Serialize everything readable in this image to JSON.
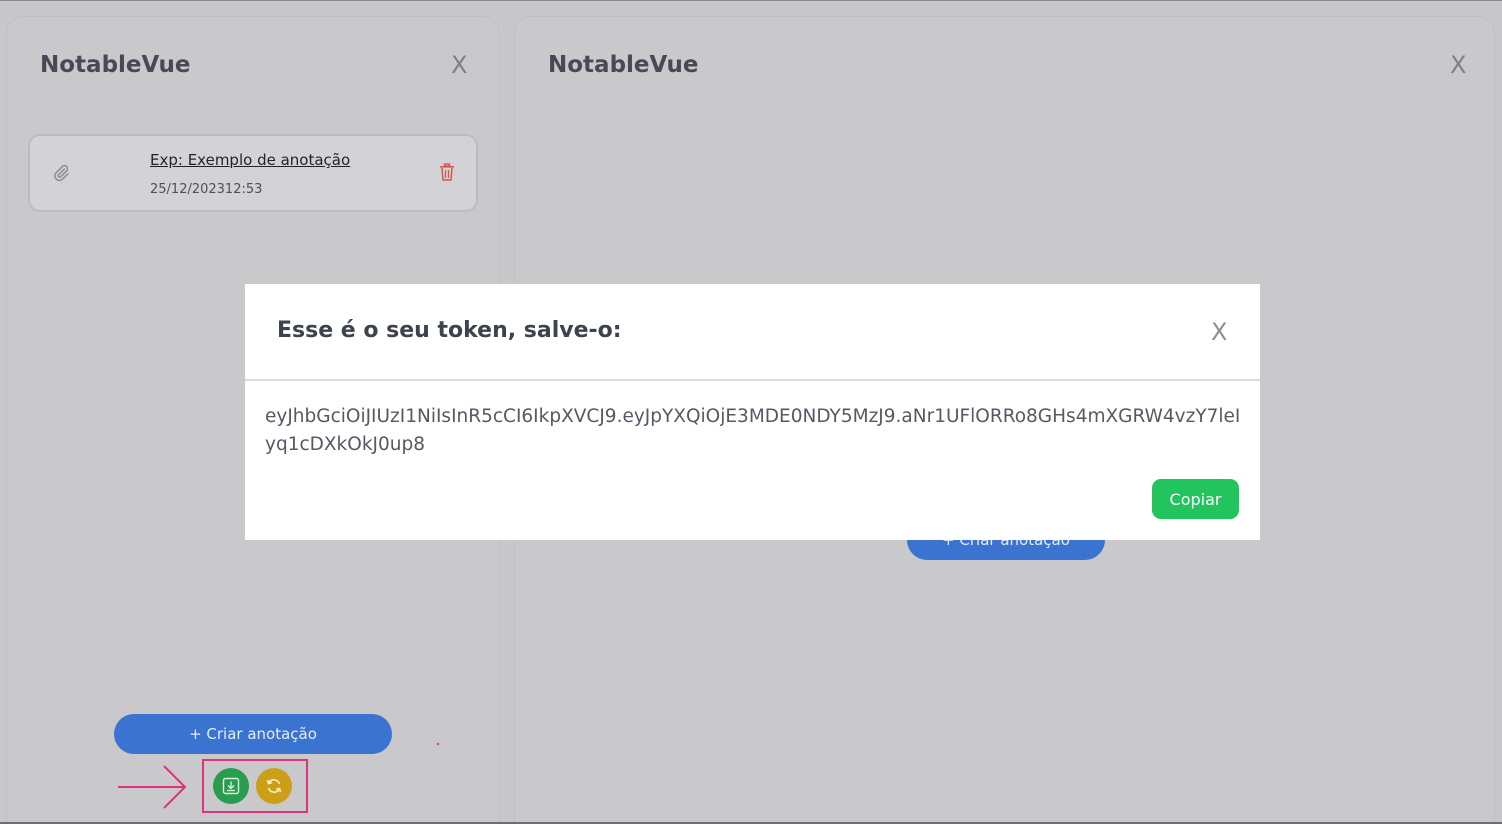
{
  "left_panel": {
    "title": "NotableVue",
    "close_label": "X",
    "note": {
      "title": "Exp: Exemplo de anotação",
      "date": "25/12/202312:53",
      "clip_icon": "paperclip-icon",
      "delete_icon": "trash-icon"
    },
    "create_label": "+ Criar anotação",
    "actions": {
      "download_icon": "download-icon",
      "sync_icon": "sync-icon"
    }
  },
  "right_panel": {
    "title": "NotableVue",
    "close_label": "X",
    "create_label": "+ Criar anotação"
  },
  "modal": {
    "title": "Esse é o seu token, salve-o:",
    "close_label": "X",
    "token": "eyJhbGciOiJIUzI1NiIsInR5cCI6IkpXVCJ9.eyJpYXQiOjE3MDE0NDY5MzJ9.aNr1UFlORRo8GHs4mXGRW4vzY7leIyq1cDXkOkJ0up8",
    "copy_label": "Copiar"
  },
  "colors": {
    "primary_blue": "#3a74d0",
    "green": "#22c45e",
    "yellow": "#cc9f18",
    "highlight_pink": "#e0337f",
    "delete_red": "#d9534f"
  }
}
